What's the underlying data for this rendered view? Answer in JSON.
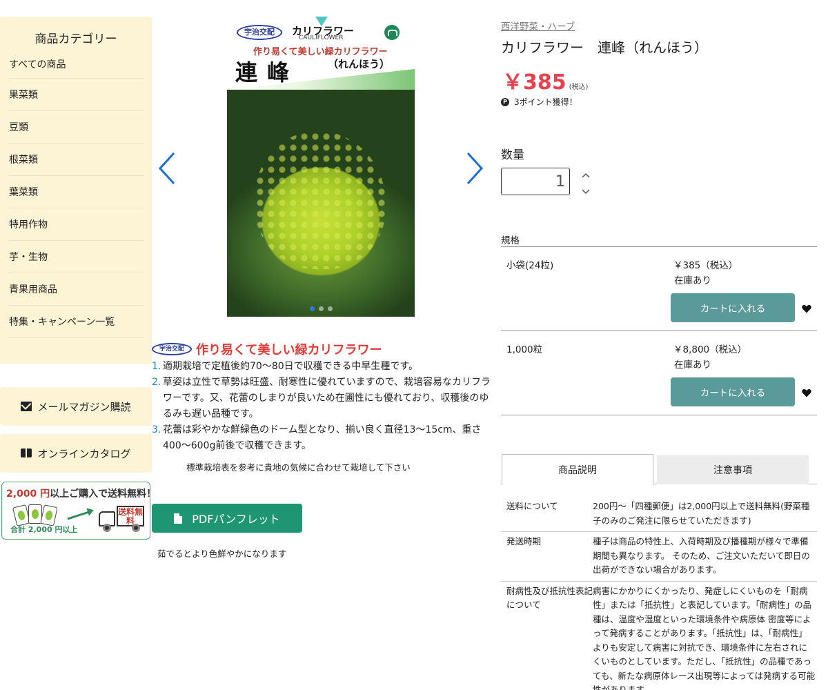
{
  "sidebar": {
    "title": "商品カテゴリー",
    "items": [
      "すべての商品",
      "果菜類",
      "豆類",
      "根菜類",
      "葉菜類",
      "特用作物",
      "芋・生物",
      "青果用商品",
      "特集・キャンペーン一覧"
    ],
    "newsletter_label": "メールマガジン購読",
    "catalog_label": "オンラインカタログ",
    "shipping_banner": {
      "amount": "2,000 円",
      "text": "以上ご購入で送料無料！",
      "sub": "合計 2,000 円以上",
      "truck_label": "送料無料"
    }
  },
  "gallery": {
    "badge": "宇治交配",
    "name": "カリフラワー",
    "name_en": "CAULIFLOWER",
    "catch": "作り易くて美しい緑カリフラワー",
    "title": "連峰",
    "yomi": "（れんほう）",
    "slide_count": 3,
    "active_slide": 1
  },
  "description": {
    "badge": "宇治交配",
    "catch": "作り易くて美しい緑カリフラワー",
    "points": [
      {
        "num": "1.",
        "text": "適期栽培で定植後約70〜80日で収穫できる中早生種です。"
      },
      {
        "num": "2.",
        "text": "草姿は立性で草勢は旺盛、耐寒性に優れていますので、栽培容易なカリフラワーです。又、花蕾のしまりが良いため在圃性にも優れており、収穫後のゆるみも遅い品種です。"
      },
      {
        "num": "3.",
        "text": "花蕾は彩やかな鮮緑色のドーム型となり、揃い良く直径13〜15cm、重さ400〜600g前後で収穫できます。"
      }
    ],
    "note": "標準栽培表を参考に貴地の気候に合わせて栽培して下さい",
    "pdf_label": "PDFパンフレット",
    "note2": "茹でるとより色鮮やかになります"
  },
  "product": {
    "breadcrumb": "西洋野菜・ハーブ",
    "title": "カリフラワー　連峰（れんほう）",
    "price": "￥385",
    "tax": "(税込)",
    "points": "3ポイント獲得！",
    "qty_label": "数量",
    "qty_value": "1",
    "spec_label": "規格",
    "variants": [
      {
        "name": "小袋(24粒)",
        "price": "￥385（税込）",
        "stock": "在庫あり",
        "cart": "カートに入れる"
      },
      {
        "name": "1,000粒",
        "price": "￥8,800（税込）",
        "stock": "在庫あり",
        "cart": "カートに入れる"
      }
    ]
  },
  "tabs": {
    "active": "商品説明",
    "inactive": "注意事項"
  },
  "info": [
    {
      "k": "送料について",
      "v": "200円〜「四種郵便」は2,000円以上で送料無料(野菜種子のみのご発注に限らせていただきます)"
    },
    {
      "k": "発送時期",
      "v": "種子は商品の特性上、入荷時期及び播種期が様々で準備期間も異なります。 そのため、ご注文いただいて即日の出荷ができない場合があります。"
    },
    {
      "k": "耐病性及び抵抗性表記について",
      "v": "病害にかかりにくかったり、発症しにくいものを「耐病性」または「抵抗性」と表記しています。「耐病性」の品種は、温度や湿度といった環境条件や病原体 密度等によって発病することがあります。「抵抗性」は、「耐病性」よりも安定して病害に対抗でき、環境条件に左右されにくいものとしています。ただし、「抵抗性」の品種であっても、新たな病原体レース出現等によっては発病する可能性があります。"
    }
  ],
  "colors": {
    "sidebar_bg": "#fdf3d5",
    "price": "#e8424f",
    "cart_button": "#5b9a9a",
    "pdf_button": "#1f9673",
    "catch": "#e53935",
    "arrow": "#1a6fd1"
  }
}
